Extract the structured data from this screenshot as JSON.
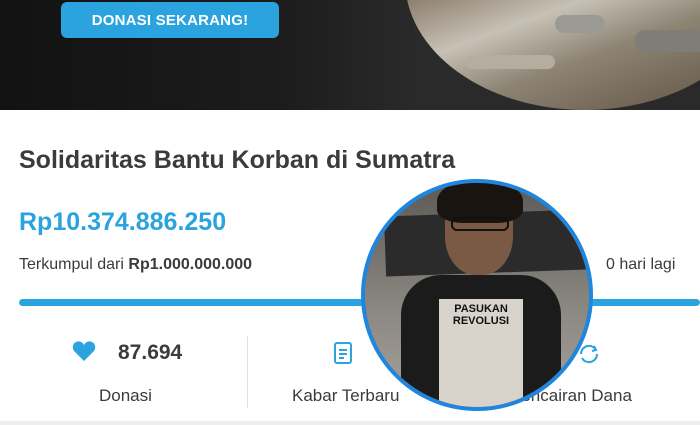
{
  "banner": {
    "donate_button": "DONASI SEKARANG!"
  },
  "campaign": {
    "title": "Solidaritas Bantu Korban di Sumatra",
    "amount_collected": "Rp10.374.886.250",
    "collected_from_prefix": "Terkumpul dari",
    "target_amount": "Rp1.000.000.000",
    "days_left": "0 hari lagi",
    "progress_fraction": 1.0
  },
  "stats": {
    "donations_count": "87.694",
    "donations_label": "Donasi",
    "news_label": "Kabar Terbaru",
    "withdrawal_label": "Pencairan Dana"
  },
  "avatar": {
    "shirt_text": "PASUKAN REVOLUSI"
  },
  "colors": {
    "accent": "#2aa3de",
    "avatar_border": "#1f86e0",
    "text": "#3b3b3b"
  }
}
